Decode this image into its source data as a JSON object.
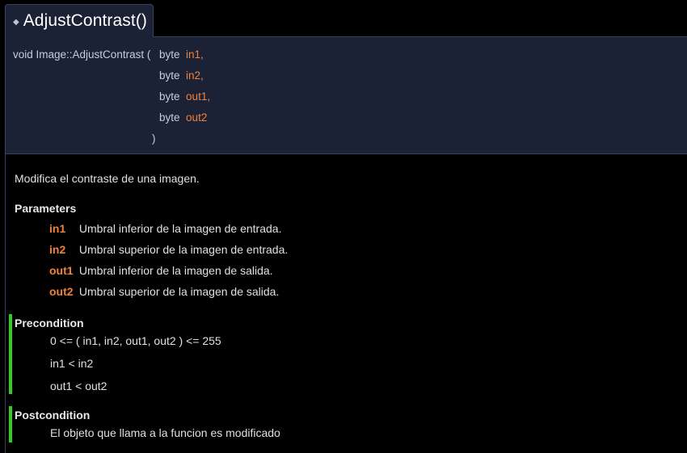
{
  "header": {
    "bullet": "◆",
    "title": "AdjustContrast()"
  },
  "prototype": {
    "declaration": "void Image::AdjustContrast (",
    "params": [
      {
        "type": "byte",
        "name": "in1,"
      },
      {
        "type": "byte",
        "name": "in2,"
      },
      {
        "type": "byte",
        "name": "out1,"
      },
      {
        "type": "byte",
        "name": "out2"
      }
    ],
    "close": ")"
  },
  "doc": {
    "brief": "Modifica el contraste de una imagen.",
    "parameters_title": "Parameters",
    "parameters": [
      {
        "name": "in1",
        "desc": "Umbral inferior de la imagen de entrada."
      },
      {
        "name": "in2",
        "desc": "Umbral superior de la imagen de entrada."
      },
      {
        "name": "out1",
        "desc": "Umbral inferior de la imagen de salida."
      },
      {
        "name": "out2",
        "desc": "Umbral superior de la imagen de salida."
      }
    ],
    "precondition_title": "Precondition",
    "preconditions": [
      "0 <= ( in1, in2, out1, out2 ) <= 255",
      "in1 < in2",
      "out1 < out2"
    ],
    "postcondition_title": "Postcondition",
    "postconditions": [
      "El objeto que llama a la funcion es modificado"
    ]
  },
  "colors": {
    "background": "#000000",
    "header_bg": "#1b2236",
    "border": "#38415c",
    "param_accent": "#f0833a",
    "condition_bar": "#2fcc22"
  }
}
